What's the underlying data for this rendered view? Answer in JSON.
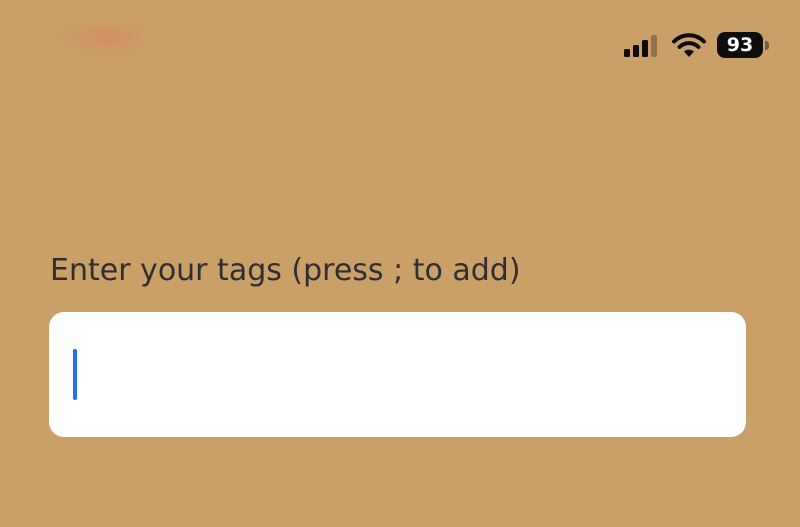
{
  "status_bar": {
    "signal_icon": "cellular-signal-icon",
    "wifi_icon": "wifi-icon",
    "battery_icon": "battery-icon",
    "battery_level": "93"
  },
  "tags_field": {
    "label": "Enter your tags (press ; to add)",
    "value": "",
    "placeholder": ""
  },
  "colors": {
    "background": "#C9A068",
    "label_text": "#2f2f33",
    "input_background": "#ffffff",
    "caret": "#1f6ff2"
  }
}
